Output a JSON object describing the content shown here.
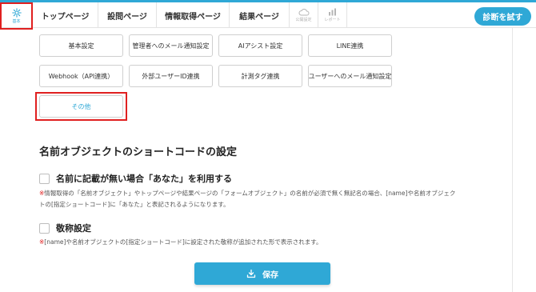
{
  "colors": {
    "accent": "#2fa8d6",
    "highlight": "#e02020"
  },
  "nav": {
    "home_label": "基本",
    "tabs": [
      {
        "label": "トップページ"
      },
      {
        "label": "設問ページ"
      },
      {
        "label": "情報取得ページ"
      },
      {
        "label": "結果ページ"
      }
    ],
    "icon_tabs": [
      {
        "label": "公開設定",
        "icon": "cloud-icon"
      },
      {
        "label": "レポート",
        "icon": "bar-chart-icon"
      }
    ],
    "try_button": "診断を試す"
  },
  "settings_tiles": [
    {
      "label": "基本設定"
    },
    {
      "label": "管理者へのメール通知設定"
    },
    {
      "label": "AIアシスト設定"
    },
    {
      "label": "LINE連携"
    },
    {
      "label": "Webhook（API連携）"
    },
    {
      "label": "外部ユーザーID連携"
    },
    {
      "label": "計測タグ連携"
    },
    {
      "label": "ユーザーへのメール通知設定"
    },
    {
      "label": "その他"
    }
  ],
  "section": {
    "title": "名前オブジェクトのショートコードの設定",
    "option1": {
      "label": "名前に記載が無い場合「あなた」を利用する",
      "note_mark": "※",
      "note_line1": "情報取得の「名前オブジェクト」やトップページや結果ページの「フォームオブジェクト」の名前が必須で無く無記名の場合、[name]や名前オブジェク",
      "note_line2": "トの[指定ショートコード]に「あなた」と表記されるようになります。"
    },
    "option2": {
      "label": "敬称設定",
      "note_mark": "※",
      "note_line1": "[name]や名前オブジェクトの[指定ショートコード]に設定された敬称が追加された形で表示されます。"
    }
  },
  "save_button": "保存"
}
